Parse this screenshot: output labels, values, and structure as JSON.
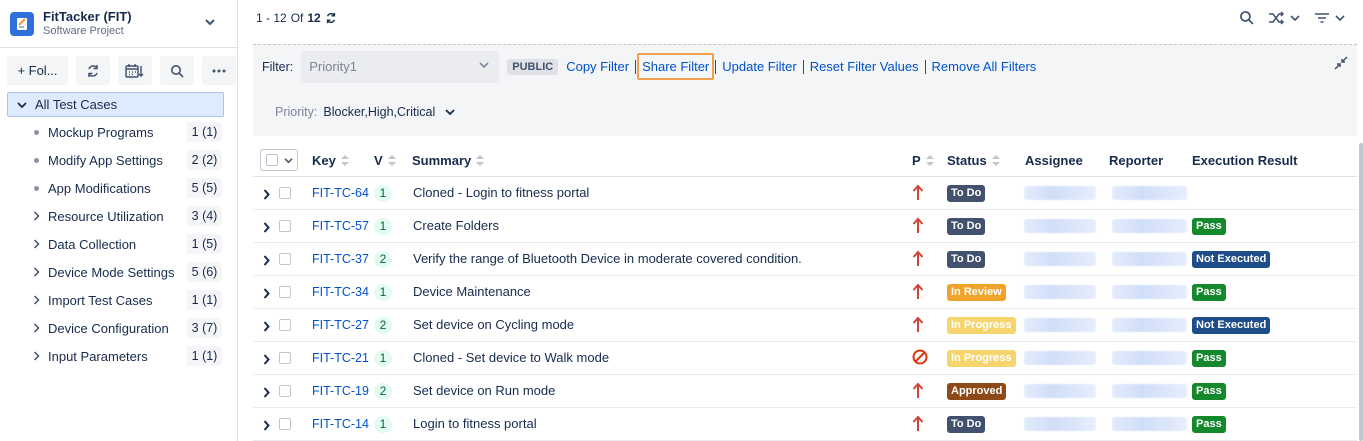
{
  "project": {
    "name": "FitTacker (FIT)",
    "type": "Software Project"
  },
  "sidebar": {
    "toolbar": {
      "folder_label": "+ Fol..."
    },
    "root_label": "All Test Cases",
    "items": [
      {
        "label": "Mockup Programs",
        "count": "1 (1)",
        "marker": "dot"
      },
      {
        "label": "Modify App Settings",
        "count": "2 (2)",
        "marker": "dot"
      },
      {
        "label": "App Modifications",
        "count": "5 (5)",
        "marker": "dot"
      },
      {
        "label": "Resource Utilization",
        "count": "3 (4)",
        "marker": "chevron"
      },
      {
        "label": "Data Collection",
        "count": "1 (5)",
        "marker": "chevron"
      },
      {
        "label": "Device Mode Settings",
        "count": "5 (6)",
        "marker": "chevron"
      },
      {
        "label": "Import Test Cases",
        "count": "1 (1)",
        "marker": "chevron"
      },
      {
        "label": "Device Configuration",
        "count": "3 (7)",
        "marker": "chevron"
      },
      {
        "label": "Input Parameters",
        "count": "1 (1)",
        "marker": "chevron"
      }
    ]
  },
  "pager": {
    "range": "1 - 12",
    "of": "Of",
    "total": "12"
  },
  "filter": {
    "label": "Filter:",
    "placeholder": "Priority1",
    "badge": "PUBLIC",
    "actions": [
      "Copy Filter",
      "Share Filter",
      "Update Filter",
      "Reset Filter Values",
      "Remove All Filters"
    ]
  },
  "priority_filter": {
    "label": "Priority:",
    "value": "Blocker,High,Critical"
  },
  "columns": {
    "key": "Key",
    "version": "V",
    "summary": "Summary",
    "priority": "P",
    "status": "Status",
    "assignee": "Assignee",
    "reporter": "Reporter",
    "result": "Execution Result"
  },
  "rows": [
    {
      "key": "FIT-TC-64",
      "version": "1",
      "summary": "Cloned - Login to fitness portal",
      "priority": "high",
      "status": "To Do",
      "status_style": "todo",
      "result": "",
      "result_style": ""
    },
    {
      "key": "FIT-TC-57",
      "version": "1",
      "summary": "Create Folders",
      "priority": "high",
      "status": "To Do",
      "status_style": "todo",
      "result": "Pass",
      "result_style": "pass"
    },
    {
      "key": "FIT-TC-37",
      "version": "2",
      "summary": "Verify the range of Bluetooth Device in moderate covered condition.",
      "priority": "high",
      "status": "To Do",
      "status_style": "todo",
      "result": "Not Executed",
      "result_style": "notexec"
    },
    {
      "key": "FIT-TC-34",
      "version": "1",
      "summary": "Device Maintenance",
      "priority": "high",
      "status": "In Review",
      "status_style": "review",
      "result": "Pass",
      "result_style": "pass"
    },
    {
      "key": "FIT-TC-27",
      "version": "2",
      "summary": "Set device on Cycling mode",
      "priority": "high",
      "status": "In Progress",
      "status_style": "progress",
      "result": "Not Executed",
      "result_style": "notexec"
    },
    {
      "key": "FIT-TC-21",
      "version": "1",
      "summary": "Cloned - Set device to Walk mode",
      "priority": "blocker",
      "status": "In Progress",
      "status_style": "progress",
      "result": "Pass",
      "result_style": "pass"
    },
    {
      "key": "FIT-TC-19",
      "version": "2",
      "summary": "Set device on Run mode",
      "priority": "high",
      "status": "Approved",
      "status_style": "approved",
      "result": "Pass",
      "result_style": "pass"
    },
    {
      "key": "FIT-TC-14",
      "version": "1",
      "summary": "Login to fitness portal",
      "priority": "high",
      "status": "To Do",
      "status_style": "todo",
      "result": "Pass",
      "result_style": "pass"
    }
  ]
}
